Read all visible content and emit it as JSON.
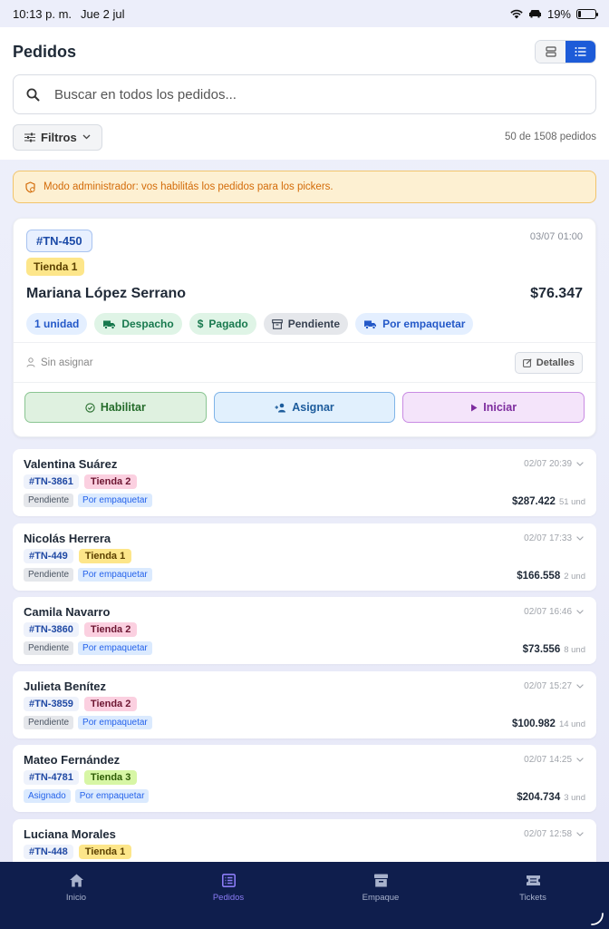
{
  "status": {
    "time": "10:13 p. m.",
    "date": "Jue 2 jul",
    "battery": "19%",
    "battery_level": 0.19
  },
  "header": {
    "title": "Pedidos"
  },
  "view_toggle": {
    "options": [
      "grid-view-icon",
      "list-view-icon"
    ],
    "selected": "list"
  },
  "search": {
    "placeholder": "Buscar en todos los pedidos..."
  },
  "filters": {
    "label": "Filtros",
    "count": "50 de 1508 pedidos"
  },
  "banner": {
    "text": "Modo administrador: vos habilitás los pedidos para los pickers."
  },
  "featured": {
    "id": "#TN-450",
    "date": "03/07  01:00",
    "store": "Tienda 1",
    "customer": "Mariana López Serrano",
    "amount": "$76.347",
    "chips": {
      "units": "1 unidad",
      "shipping": "Despacho",
      "payment": "Pagado",
      "status": "Pendiente",
      "pack": "Por empaquetar"
    },
    "assignee": "Sin asignar",
    "details": "Detalles",
    "actions": {
      "enable": "Habilitar",
      "assign": "Asignar",
      "start": "Iniciar"
    }
  },
  "orders": [
    {
      "name": "Valentina Suárez",
      "date": "02/07  20:39",
      "id": "#TN-3861",
      "store": "Tienda 2",
      "status": "Pendiente",
      "pack": "Por empaquetar",
      "amount": "$287.422",
      "units": "51 und"
    },
    {
      "name": "Nicolás Herrera",
      "date": "02/07  17:33",
      "id": "#TN-449",
      "store": "Tienda 1",
      "status": "Pendiente",
      "pack": "Por empaquetar",
      "amount": "$166.558",
      "units": "2 und"
    },
    {
      "name": "Camila Navarro",
      "date": "02/07  16:46",
      "id": "#TN-3860",
      "store": "Tienda 2",
      "status": "Pendiente",
      "pack": "Por empaquetar",
      "amount": "$73.556",
      "units": "8 und"
    },
    {
      "name": "Julieta Benítez",
      "date": "02/07  15:27",
      "id": "#TN-3859",
      "store": "Tienda 2",
      "status": "Pendiente",
      "pack": "Por empaquetar",
      "amount": "$100.982",
      "units": "14 und"
    },
    {
      "name": "Mateo Fernández",
      "date": "02/07  14:25",
      "id": "#TN-4781",
      "store": "Tienda 3",
      "status": "Asignado",
      "pack": "Por empaquetar",
      "amount": "$204.734",
      "units": "3 und"
    },
    {
      "name": "Luciana Morales",
      "date": "02/07  12:58",
      "id": "#TN-448",
      "store": "Tienda 1",
      "status": "",
      "pack": "",
      "amount": "",
      "units": ""
    }
  ],
  "tabs": {
    "home": "Inicio",
    "orders": "Pedidos",
    "packing": "Empaque",
    "tickets": "Tickets"
  },
  "colors": {
    "accent": "#1d5bd8",
    "tabbar": "#0f1e4d",
    "tab_active": "#8b7cf6"
  }
}
